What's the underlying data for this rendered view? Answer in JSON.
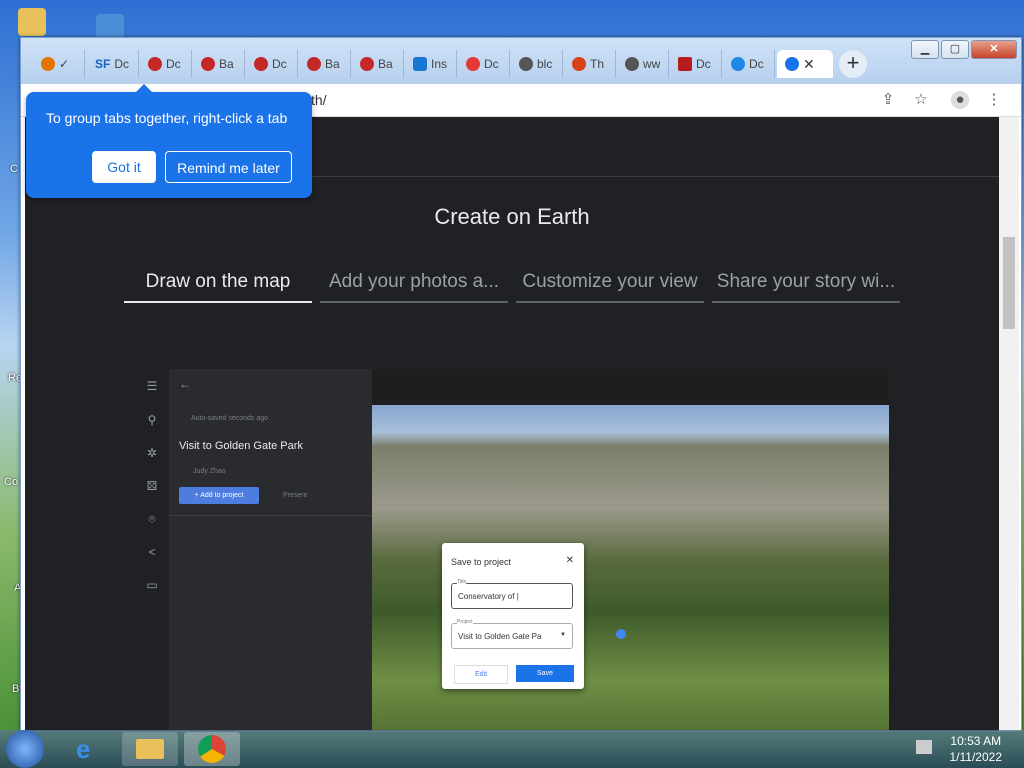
{
  "browser": {
    "tabs": [
      {
        "label": "",
        "fav_color": "#e37400"
      },
      {
        "label": "Dc",
        "fav_color": "#1565c0"
      },
      {
        "label": "Dc",
        "fav_color": "#c62828"
      },
      {
        "label": "Ba",
        "fav_color": "#c62828"
      },
      {
        "label": "Dc",
        "fav_color": "#c62828"
      },
      {
        "label": "Ba",
        "fav_color": "#c62828"
      },
      {
        "label": "Ba",
        "fav_color": "#c62828"
      },
      {
        "label": "Ins",
        "fav_color": "#1976d2"
      },
      {
        "label": "Dc",
        "fav_color": "#e53935"
      },
      {
        "label": "blc",
        "fav_color": "#555555"
      },
      {
        "label": "Th",
        "fav_color": "#d84315"
      },
      {
        "label": "ww",
        "fav_color": "#555555"
      },
      {
        "label": "Dc",
        "fav_color": "#b71c1c"
      },
      {
        "label": "Dc",
        "fav_color": "#1e88e5"
      },
      {
        "label": "",
        "fav_color": "#1a73e8"
      }
    ],
    "url_text": "th/"
  },
  "tooltip": {
    "text": "To group tabs together, right-click a tab",
    "got_it": "Got it",
    "remind": "Remind me later"
  },
  "page": {
    "title": "Create on Earth",
    "feature_tabs": [
      "Draw on the map",
      "Add your photos a...",
      "Customize your view",
      "Share your story wi..."
    ]
  },
  "demo": {
    "autosave": "Auto-saved seconds ago",
    "project_title": "Visit to Golden Gate Park",
    "author": "Judy Zhao",
    "add_to_project": "+ Add to project",
    "present": "Present",
    "dialog": {
      "title": "Save to project",
      "title_label": "Title",
      "title_value": "Conservatory of |",
      "project_label": "Project",
      "project_value": "Visit to Golden Gate Pa",
      "edit": "Edit",
      "save": "Save"
    }
  },
  "desktop": {
    "labels": [
      "C",
      "Re",
      "Co",
      "A",
      "B"
    ]
  },
  "taskbar": {
    "time": "10:53 AM",
    "date": "1/11/2022"
  }
}
